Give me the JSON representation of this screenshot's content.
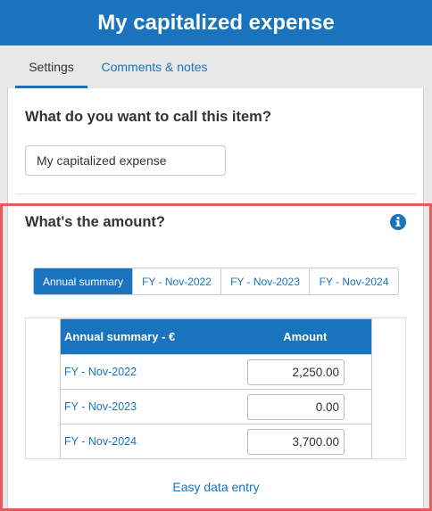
{
  "header": {
    "title": "My capitalized expense"
  },
  "tabs": [
    {
      "label": "Settings"
    },
    {
      "label": "Comments & notes"
    }
  ],
  "name_section": {
    "question": "What do you want to call this item?",
    "value": "My capitalized expense"
  },
  "amount_section": {
    "question": "What's the amount?",
    "info_icon": "info-circle-icon",
    "segments": [
      {
        "label": "Annual summary"
      },
      {
        "label": "FY - Nov-2022"
      },
      {
        "label": "FY - Nov-2023"
      },
      {
        "label": "FY - Nov-2024"
      }
    ],
    "table": {
      "headers": [
        "Annual summary - €",
        "Amount"
      ],
      "rows": [
        {
          "label": "FY - Nov-2022",
          "value": "2,250.00"
        },
        {
          "label": "FY - Nov-2023",
          "value": "0.00"
        },
        {
          "label": "FY - Nov-2024",
          "value": "3,700.00"
        }
      ]
    },
    "easy_entry": "Easy data entry"
  },
  "colors": {
    "accent": "#1a73bd",
    "highlight": "#e55a5a"
  }
}
